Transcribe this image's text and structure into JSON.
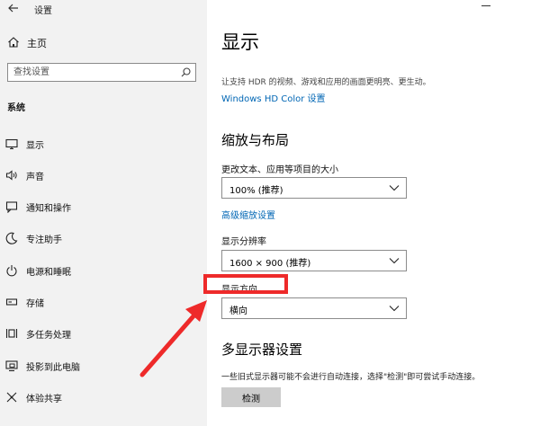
{
  "app": {
    "title": "设置"
  },
  "sidebar": {
    "home_label": "主页",
    "search_placeholder": "查找设置",
    "section_title": "系统",
    "items": [
      {
        "label": "显示",
        "icon": "monitor-icon"
      },
      {
        "label": "声音",
        "icon": "speaker-icon"
      },
      {
        "label": "通知和操作",
        "icon": "notification-icon"
      },
      {
        "label": "专注助手",
        "icon": "moon-icon"
      },
      {
        "label": "电源和睡眠",
        "icon": "power-icon"
      },
      {
        "label": "存储",
        "icon": "storage-icon"
      },
      {
        "label": "多任务处理",
        "icon": "multitask-icon"
      },
      {
        "label": "投影到此电脑",
        "icon": "project-icon"
      },
      {
        "label": "体验共享",
        "icon": "share-icon"
      }
    ]
  },
  "main": {
    "title": "显示",
    "description": "让支持 HDR 的视频、游戏和应用的画面更明亮、更生动。",
    "hdr_link": "Windows HD Color 设置",
    "scale_layout": {
      "heading": "缩放与布局",
      "scale_label": "更改文本、应用等项目的大小",
      "scale_value": "100% (推荐)",
      "advanced_link": "高级缩放设置",
      "resolution_label": "显示分辨率",
      "resolution_value": "1600 × 900 (推荐)",
      "orientation_label": "显示方向",
      "orientation_value": "横向"
    },
    "multi_display": {
      "heading": "多显示器设置",
      "description": "一些旧式显示器可能不会进行自动连接，选择\"检测\"即可尝试手动连接。",
      "detect_button": "检测"
    }
  },
  "colors": {
    "sidebar_bg": "#f2f2f2",
    "link": "#0066b4",
    "annotation": "#ee2a2a",
    "button_bg": "#cccccc"
  }
}
